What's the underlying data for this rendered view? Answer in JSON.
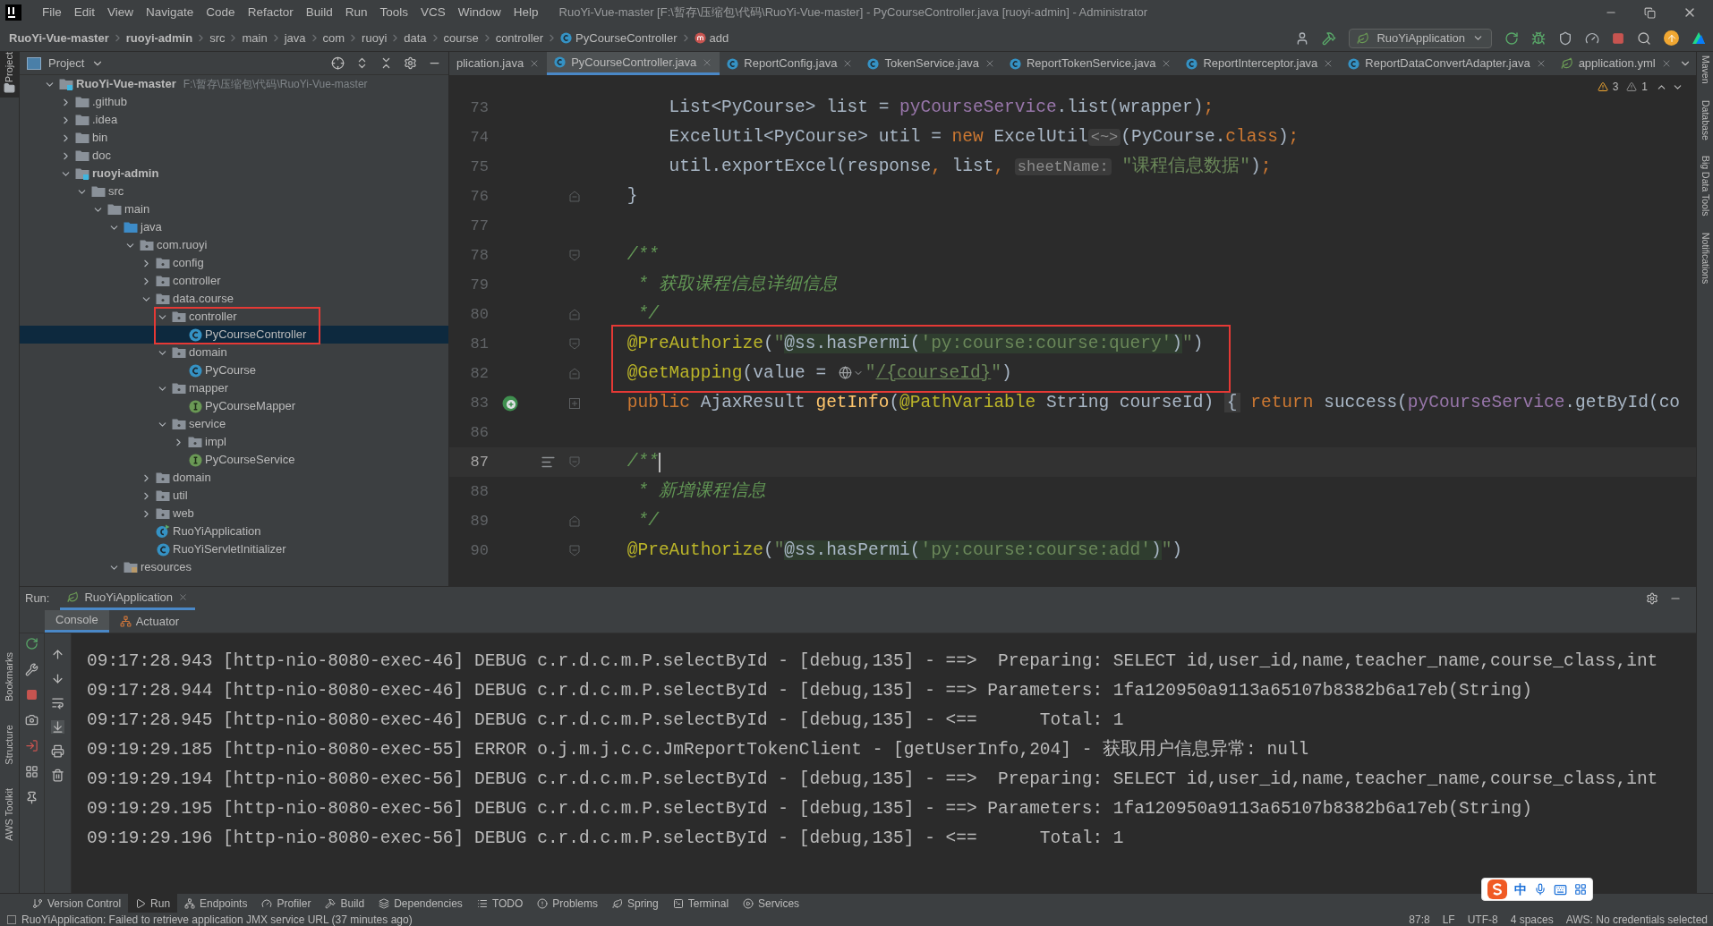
{
  "window": {
    "title": "RuoYi-Vue-master [F:\\暂存\\压缩包\\代码\\RuoYi-Vue-master] - PyCourseController.java [ruoyi-admin] - Administrator"
  },
  "menu": [
    "File",
    "Edit",
    "View",
    "Navigate",
    "Code",
    "Refactor",
    "Build",
    "Run",
    "Tools",
    "VCS",
    "Window",
    "Help"
  ],
  "breadcrumbs": [
    {
      "label": "RuoYi-Vue-master",
      "kind": "module"
    },
    {
      "label": "ruoyi-admin",
      "kind": "module"
    },
    {
      "label": "src",
      "kind": "dir"
    },
    {
      "label": "main",
      "kind": "dir"
    },
    {
      "label": "java",
      "kind": "dir"
    },
    {
      "label": "com",
      "kind": "dir"
    },
    {
      "label": "ruoyi",
      "kind": "dir"
    },
    {
      "label": "data",
      "kind": "dir"
    },
    {
      "label": "course",
      "kind": "dir"
    },
    {
      "label": "controller",
      "kind": "dir"
    },
    {
      "label": "PyCourseController",
      "kind": "class"
    },
    {
      "label": "add",
      "kind": "method"
    }
  ],
  "run_config": {
    "label": "RuoYiApplication"
  },
  "left_stripe": {
    "top": [
      "Project"
    ],
    "bottom": [
      "Bookmarks",
      "Structure",
      "AWS Toolkit"
    ]
  },
  "right_stripe": [
    "Maven",
    "Database",
    "Big Data Tools",
    "Notifications"
  ],
  "project_panel": {
    "title": "Project"
  },
  "project_tree": [
    {
      "label": "RuoYi-Vue-master",
      "path": "F:\\暂存\\压缩包\\代码\\RuoYi-Vue-master",
      "kind": "module",
      "expanded": true,
      "selected": false,
      "boxed": false,
      "children": [
        {
          "label": ".github",
          "kind": "folder",
          "expanded": false,
          "selected": false,
          "boxed": false
        },
        {
          "label": ".idea",
          "kind": "folder",
          "expanded": false,
          "selected": false,
          "boxed": false
        },
        {
          "label": "bin",
          "kind": "folder",
          "expanded": false,
          "selected": false,
          "boxed": false
        },
        {
          "label": "doc",
          "kind": "folder",
          "expanded": false,
          "selected": false,
          "boxed": false
        },
        {
          "label": "ruoyi-admin",
          "kind": "module",
          "expanded": true,
          "selected": false,
          "boxed": false,
          "children": [
            {
              "label": "src",
              "kind": "folder",
              "expanded": true,
              "selected": false,
              "boxed": false,
              "children": [
                {
                  "label": "main",
                  "kind": "folder",
                  "expanded": true,
                  "selected": false,
                  "boxed": false,
                  "children": [
                    {
                      "label": "java",
                      "kind": "source",
                      "expanded": true,
                      "selected": false,
                      "boxed": false,
                      "children": [
                        {
                          "label": "com.ruoyi",
                          "kind": "package",
                          "expanded": true,
                          "selected": false,
                          "boxed": false,
                          "children": [
                            {
                              "label": "config",
                              "kind": "package",
                              "expanded": false,
                              "selected": false,
                              "boxed": false
                            },
                            {
                              "label": "controller",
                              "kind": "package",
                              "expanded": false,
                              "selected": false,
                              "boxed": false
                            },
                            {
                              "label": "data.course",
                              "kind": "package",
                              "expanded": true,
                              "selected": false,
                              "boxed": false,
                              "children": [
                                {
                                  "label": "controller",
                                  "kind": "package",
                                  "expanded": true,
                                  "selected": false,
                                  "boxed": true,
                                  "children": [
                                    {
                                      "label": "PyCourseController",
                                      "kind": "class",
                                      "selected": true,
                                      "boxed": false
                                    }
                                  ]
                                },
                                {
                                  "label": "domain",
                                  "kind": "package",
                                  "expanded": true,
                                  "selected": false,
                                  "boxed": false,
                                  "children": [
                                    {
                                      "label": "PyCourse",
                                      "kind": "class",
                                      "selected": false,
                                      "boxed": false
                                    }
                                  ]
                                },
                                {
                                  "label": "mapper",
                                  "kind": "package",
                                  "expanded": true,
                                  "selected": false,
                                  "boxed": false,
                                  "children": [
                                    {
                                      "label": "PyCourseMapper",
                                      "kind": "interface",
                                      "selected": false,
                                      "boxed": false
                                    }
                                  ]
                                },
                                {
                                  "label": "service",
                                  "kind": "package",
                                  "expanded": true,
                                  "selected": false,
                                  "boxed": false,
                                  "children": [
                                    {
                                      "label": "impl",
                                      "kind": "package",
                                      "expanded": false,
                                      "selected": false,
                                      "boxed": false
                                    },
                                    {
                                      "label": "PyCourseService",
                                      "kind": "interface",
                                      "selected": false,
                                      "boxed": false
                                    }
                                  ]
                                }
                              ]
                            },
                            {
                              "label": "domain",
                              "kind": "package",
                              "expanded": false,
                              "selected": false,
                              "boxed": false
                            },
                            {
                              "label": "util",
                              "kind": "package",
                              "expanded": false,
                              "selected": false,
                              "boxed": false
                            },
                            {
                              "label": "web",
                              "kind": "package",
                              "expanded": false,
                              "selected": false,
                              "boxed": false
                            },
                            {
                              "label": "RuoYiApplication",
                              "kind": "app",
                              "selected": false,
                              "boxed": false
                            },
                            {
                              "label": "RuoYiServletInitializer",
                              "kind": "class",
                              "selected": false,
                              "boxed": false
                            }
                          ]
                        }
                      ]
                    },
                    {
                      "label": "resources",
                      "kind": "resources",
                      "expanded": true,
                      "selected": false,
                      "boxed": false
                    }
                  ]
                }
              ]
            }
          ]
        }
      ]
    }
  ],
  "editor_tabs": [
    {
      "label": "plication.java",
      "selected": false
    },
    {
      "label": "PyCourseController.java",
      "kind": "class",
      "selected": true
    },
    {
      "label": "ReportConfig.java",
      "kind": "class",
      "selected": false
    },
    {
      "label": "TokenService.java",
      "kind": "class",
      "selected": false
    },
    {
      "label": "ReportTokenService.java",
      "kind": "class",
      "selected": false
    },
    {
      "label": "ReportInterceptor.java",
      "kind": "class",
      "selected": false
    },
    {
      "label": "ReportDataConvertAdapter.java",
      "kind": "class",
      "selected": false
    },
    {
      "label": "application.yml",
      "kind": "config",
      "selected": false
    }
  ],
  "inspections": {
    "warnings": "3",
    "weak_warnings": "1"
  },
  "code_lines": [
    {
      "number": "73",
      "current": false,
      "boxed": false,
      "tokens": [
        {
          "text": "        List<PyCourse> list = ",
          "kind": "plain"
        },
        {
          "text": "pyCourseService",
          "kind": "field"
        },
        {
          "text": ".list(wrapper)",
          "kind": "plain"
        },
        {
          "text": ";",
          "kind": "keyword"
        }
      ]
    },
    {
      "number": "74",
      "current": false,
      "boxed": false,
      "tokens": [
        {
          "text": "        ExcelUtil<PyCourse> util = ",
          "kind": "plain"
        },
        {
          "text": "new",
          "kind": "keyword"
        },
        {
          "text": " ExcelUtil",
          "kind": "plain"
        },
        {
          "text": "<~>",
          "kind": "hint"
        },
        {
          "text": "(PyCourse.",
          "kind": "plain"
        },
        {
          "text": "class",
          "kind": "keyword"
        },
        {
          "text": ")",
          "kind": "plain"
        },
        {
          "text": ";",
          "kind": "keyword"
        }
      ]
    },
    {
      "number": "75",
      "current": false,
      "boxed": false,
      "tokens": [
        {
          "text": "        util.exportExcel(response",
          "kind": "plain"
        },
        {
          "text": ",",
          "kind": "keyword"
        },
        {
          "text": " list",
          "kind": "plain"
        },
        {
          "text": ", ",
          "kind": "keyword"
        },
        {
          "text": "sheetName:",
          "kind": "hint"
        },
        {
          "text": " \"课程信息数据\"",
          "kind": "string"
        },
        {
          "text": ")",
          "kind": "plain"
        },
        {
          "text": ";",
          "kind": "keyword"
        }
      ]
    },
    {
      "number": "76",
      "marks": [
        {
          "kind": "fold_close"
        }
      ],
      "current": false,
      "boxed": false,
      "tokens": [
        {
          "text": "    }",
          "kind": "plain"
        }
      ]
    },
    {
      "number": "77",
      "current": false,
      "boxed": false
    },
    {
      "number": "78",
      "marks": [
        {
          "kind": "fold_open"
        }
      ],
      "current": false,
      "boxed": false,
      "tokens": [
        {
          "text": "    /**",
          "kind": "comment"
        }
      ]
    },
    {
      "number": "79",
      "current": false,
      "boxed": false,
      "tokens": [
        {
          "text": "     * 获取课程信息详细信息",
          "kind": "comment"
        }
      ]
    },
    {
      "number": "80",
      "marks": [
        {
          "kind": "fold_close"
        }
      ],
      "current": false,
      "boxed": false,
      "tokens": [
        {
          "text": "     */",
          "kind": "comment"
        }
      ]
    },
    {
      "number": "81",
      "marks": [
        {
          "kind": "fold_open"
        }
      ],
      "current": false,
      "boxed": true,
      "tokens": [
        {
          "text": "    @PreAuthorize",
          "kind": "annotation"
        },
        {
          "text": "(",
          "kind": "plain"
        },
        {
          "text": "\"",
          "kind": "string"
        },
        {
          "text": "@ss.hasPermi(",
          "kind": "inject"
        },
        {
          "text": "'py:course:course:query'",
          "kind": "inject_string"
        },
        {
          "text": ")",
          "kind": "inject"
        },
        {
          "text": "\"",
          "kind": "string"
        },
        {
          "text": ")",
          "kind": "plain"
        }
      ]
    },
    {
      "number": "82",
      "marks": [
        {
          "kind": "fold_close"
        }
      ],
      "current": false,
      "boxed": true,
      "tokens": [
        {
          "text": "    @GetMapping",
          "kind": "annotation"
        },
        {
          "text": "(value = ",
          "kind": "plain"
        },
        {
          "kind": "globe"
        },
        {
          "text": "\"",
          "kind": "string"
        },
        {
          "text": "/{courseId}",
          "kind": "link"
        },
        {
          "text": "\"",
          "kind": "string"
        },
        {
          "text": ")",
          "kind": "plain"
        }
      ]
    },
    {
      "number": "83",
      "marks": [
        {
          "kind": "bean"
        },
        {
          "kind": "fold_collapsed"
        }
      ],
      "current": false,
      "boxed": false,
      "tokens": [
        {
          "text": "    public",
          "kind": "keyword"
        },
        {
          "text": " AjaxResult ",
          "kind": "plain"
        },
        {
          "text": "getInfo",
          "kind": "method"
        },
        {
          "text": "(",
          "kind": "plain"
        },
        {
          "text": "@PathVariable",
          "kind": "annotation"
        },
        {
          "text": " String courseId) ",
          "kind": "plain"
        },
        {
          "text": "{",
          "kind": "folded"
        },
        {
          "text": " return",
          "kind": "keyword"
        },
        {
          "text": " success(",
          "kind": "plain"
        },
        {
          "text": "pyCourseService",
          "kind": "field"
        },
        {
          "text": ".getById(co",
          "kind": "plain"
        }
      ]
    },
    {
      "number": "86",
      "current": false,
      "boxed": false
    },
    {
      "number": "87",
      "marks": [
        {
          "kind": "lines"
        },
        {
          "kind": "fold_open"
        }
      ],
      "current": true,
      "boxed": false,
      "tokens": [
        {
          "text": "    /**",
          "kind": "comment"
        }
      ]
    },
    {
      "number": "88",
      "current": false,
      "boxed": false,
      "tokens": [
        {
          "text": "     * 新增课程信息",
          "kind": "comment"
        }
      ]
    },
    {
      "number": "89",
      "marks": [
        {
          "kind": "fold_close"
        }
      ],
      "current": false,
      "boxed": false,
      "tokens": [
        {
          "text": "     */",
          "kind": "comment"
        }
      ]
    },
    {
      "number": "90",
      "marks": [
        {
          "kind": "fold_open"
        }
      ],
      "current": false,
      "boxed": false,
      "tokens": [
        {
          "text": "    @PreAuthorize",
          "kind": "annotation"
        },
        {
          "text": "(",
          "kind": "plain"
        },
        {
          "text": "\"",
          "kind": "string"
        },
        {
          "text": "@ss.hasPermi(",
          "kind": "inject"
        },
        {
          "text": "'py:course:course:add'",
          "kind": "inject_string"
        },
        {
          "text": ")",
          "kind": "inject"
        },
        {
          "text": "\"",
          "kind": "string"
        },
        {
          "text": ")",
          "kind": "plain"
        }
      ]
    }
  ],
  "run_panel": {
    "label": "Run:",
    "tabs": [
      {
        "label": "RuoYiApplication",
        "selected": true
      }
    ],
    "subtabs": [
      {
        "label": "Console",
        "selected": true
      },
      {
        "label": "Actuator",
        "selected": false
      }
    ],
    "console": [
      "09:17:28.943 [http-nio-8080-exec-46] DEBUG c.r.d.c.m.P.selectById - [debug,135] - ==>  Preparing: SELECT id,user_id,name,teacher_name,course_class,int",
      "09:17:28.944 [http-nio-8080-exec-46] DEBUG c.r.d.c.m.P.selectById - [debug,135] - ==> Parameters: 1fa120950a9113a65107b8382b6a17eb(String)",
      "09:17:28.945 [http-nio-8080-exec-46] DEBUG c.r.d.c.m.P.selectById - [debug,135] - <==      Total: 1",
      "09:19:29.185 [http-nio-8080-exec-55] ERROR o.j.m.j.c.c.JmReportTokenClient - [getUserInfo,204] - 获取用户信息异常: null",
      "09:19:29.194 [http-nio-8080-exec-56] DEBUG c.r.d.c.m.P.selectById - [debug,135] - ==>  Preparing: SELECT id,user_id,name,teacher_name,course_class,int",
      "09:19:29.195 [http-nio-8080-exec-56] DEBUG c.r.d.c.m.P.selectById - [debug,135] - ==> Parameters: 1fa120950a9113a65107b8382b6a17eb(String)",
      "09:19:29.196 [http-nio-8080-exec-56] DEBUG c.r.d.c.m.P.selectById - [debug,135] - <==      Total: 1"
    ]
  },
  "tool_strip": [
    {
      "label": "Version Control",
      "selected": false
    },
    {
      "label": "Run",
      "selected": true
    },
    {
      "label": "Endpoints",
      "selected": false
    },
    {
      "label": "Profiler",
      "selected": false
    },
    {
      "label": "Build",
      "selected": false
    },
    {
      "label": "Dependencies",
      "selected": false
    },
    {
      "label": "TODO",
      "selected": false
    },
    {
      "label": "Problems",
      "selected": false
    },
    {
      "label": "Spring",
      "selected": false
    },
    {
      "label": "Terminal",
      "selected": false
    },
    {
      "label": "Services",
      "selected": false
    }
  ],
  "ime_bar": {
    "mode": "中"
  },
  "status_bar": {
    "message": "RuoYiApplication: Failed to retrieve application JMX service URL (37 minutes ago)",
    "items": [
      "87:8",
      "LF",
      "UTF-8",
      "4 spaces",
      "AWS: No credentials selected"
    ]
  }
}
